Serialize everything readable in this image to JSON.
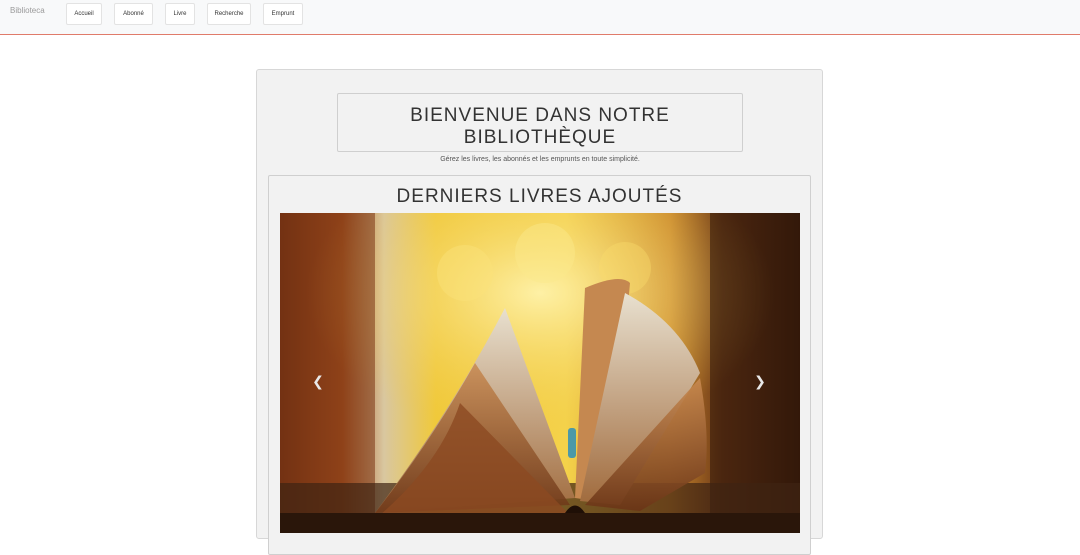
{
  "navbar": {
    "brand": "Biblioteca",
    "items": [
      {
        "label": "Accueil"
      },
      {
        "label": "Abonné"
      },
      {
        "label": "Livre"
      },
      {
        "label": "Recherche"
      },
      {
        "label": "Emprunt"
      }
    ]
  },
  "welcome": {
    "title": "BIENVENUE DANS NOTRE BIBLIOTHÈQUE",
    "subtitle": "Gérez les livres, les abonnés et les emprunts en toute simplicité."
  },
  "latest": {
    "title": "DERNIERS LIVRES AJOUTÉS",
    "prev_icon": "chevron-left-icon",
    "next_icon": "chevron-right-icon"
  },
  "colors": {
    "navbar_bg": "#f8f9fa",
    "navbar_border": "#e07b6a",
    "panel_bg": "#f2f2f2"
  }
}
